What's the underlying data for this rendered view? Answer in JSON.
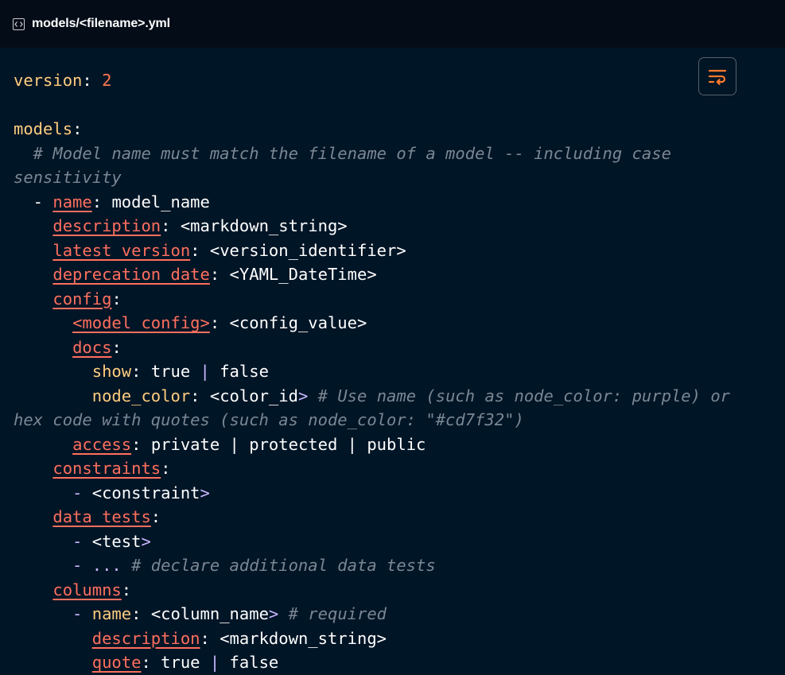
{
  "header": {
    "icon": "code-file-icon",
    "filename": "models/<filename>.yml"
  },
  "toolbar": {
    "wrap_icon": "word-wrap-icon",
    "colors": {
      "accent": "#ff7a2e",
      "border": "#56606c"
    }
  },
  "code": {
    "language": "yaml",
    "lines": [
      [
        {
          "t": "k",
          "v": "version"
        },
        {
          "t": "p",
          "v": ": "
        },
        {
          "t": "n",
          "v": "2"
        }
      ],
      [],
      [
        {
          "t": "k",
          "v": "models"
        },
        {
          "t": "p",
          "v": ":"
        }
      ],
      [
        {
          "t": "cm",
          "v": "  # Model name must match the filename of a model -- including case"
        }
      ],
      [
        {
          "t": "cm",
          "v": "sensitivity"
        }
      ],
      [
        {
          "t": "w",
          "v": "  - "
        },
        {
          "t": "key",
          "v": "name"
        },
        {
          "t": "p",
          "v": ": "
        },
        {
          "t": "w",
          "v": "model_name"
        }
      ],
      [
        {
          "t": "w",
          "v": "    "
        },
        {
          "t": "key",
          "v": "description"
        },
        {
          "t": "p",
          "v": ": "
        },
        {
          "t": "w",
          "v": "<markdown_string>"
        }
      ],
      [
        {
          "t": "w",
          "v": "    "
        },
        {
          "t": "key",
          "v": "latest_version"
        },
        {
          "t": "p",
          "v": ": "
        },
        {
          "t": "w",
          "v": "<version_identifier>"
        }
      ],
      [
        {
          "t": "w",
          "v": "    "
        },
        {
          "t": "key",
          "v": "deprecation_date"
        },
        {
          "t": "p",
          "v": ": "
        },
        {
          "t": "w",
          "v": "<YAML_DateTime>"
        }
      ],
      [
        {
          "t": "w",
          "v": "    "
        },
        {
          "t": "key",
          "v": "config"
        },
        {
          "t": "p",
          "v": ":"
        }
      ],
      [
        {
          "t": "w",
          "v": "      "
        },
        {
          "t": "key",
          "v": "<model_config>"
        },
        {
          "t": "p",
          "v": ": "
        },
        {
          "t": "w",
          "v": "<config_value>"
        }
      ],
      [
        {
          "t": "w",
          "v": "      "
        },
        {
          "t": "key",
          "v": "docs"
        },
        {
          "t": "p",
          "v": ":"
        }
      ],
      [
        {
          "t": "w",
          "v": "        "
        },
        {
          "t": "k",
          "v": "show"
        },
        {
          "t": "p",
          "v": ": "
        },
        {
          "t": "w",
          "v": "true "
        },
        {
          "t": "pu",
          "v": "|"
        },
        {
          "t": "w",
          "v": " false"
        }
      ],
      [
        {
          "t": "w",
          "v": "        "
        },
        {
          "t": "k",
          "v": "node_color"
        },
        {
          "t": "p",
          "v": ": "
        },
        {
          "t": "w",
          "v": "<color_id"
        },
        {
          "t": "pu",
          "v": ">"
        },
        {
          "t": "cm",
          "v": " # Use name (such as node_color: purple) or"
        }
      ],
      [
        {
          "t": "cm",
          "v": "hex code with quotes (such as node_color: \"#cd7f32\")"
        }
      ],
      [
        {
          "t": "w",
          "v": "      "
        },
        {
          "t": "key",
          "v": "access"
        },
        {
          "t": "p",
          "v": ": "
        },
        {
          "t": "w",
          "v": "private | protected | public"
        }
      ],
      [
        {
          "t": "w",
          "v": "    "
        },
        {
          "t": "key",
          "v": "constraints"
        },
        {
          "t": "p",
          "v": ":"
        }
      ],
      [
        {
          "t": "pu",
          "v": "      - "
        },
        {
          "t": "w",
          "v": "<constraint"
        },
        {
          "t": "pu",
          "v": ">"
        }
      ],
      [
        {
          "t": "w",
          "v": "    "
        },
        {
          "t": "key",
          "v": "data_tests"
        },
        {
          "t": "p",
          "v": ":"
        }
      ],
      [
        {
          "t": "pu",
          "v": "      - "
        },
        {
          "t": "w",
          "v": "<test"
        },
        {
          "t": "pu",
          "v": ">"
        }
      ],
      [
        {
          "t": "pu",
          "v": "      - ..."
        },
        {
          "t": "cm",
          "v": " # declare additional data tests"
        }
      ],
      [
        {
          "t": "w",
          "v": "    "
        },
        {
          "t": "key",
          "v": "columns"
        },
        {
          "t": "p",
          "v": ":"
        }
      ],
      [
        {
          "t": "pu",
          "v": "      - "
        },
        {
          "t": "k",
          "v": "name"
        },
        {
          "t": "p",
          "v": ": "
        },
        {
          "t": "w",
          "v": "<column_name"
        },
        {
          "t": "pu",
          "v": ">"
        },
        {
          "t": "cm",
          "v": " # required"
        }
      ],
      [
        {
          "t": "w",
          "v": "        "
        },
        {
          "t": "key",
          "v": "description"
        },
        {
          "t": "p",
          "v": ": "
        },
        {
          "t": "w",
          "v": "<markdown_string>"
        }
      ],
      [
        {
          "t": "w",
          "v": "        "
        },
        {
          "t": "key",
          "v": "quote"
        },
        {
          "t": "p",
          "v": ": "
        },
        {
          "t": "w",
          "v": "true "
        },
        {
          "t": "pu",
          "v": "|"
        },
        {
          "t": "w",
          "v": " false"
        }
      ]
    ]
  }
}
